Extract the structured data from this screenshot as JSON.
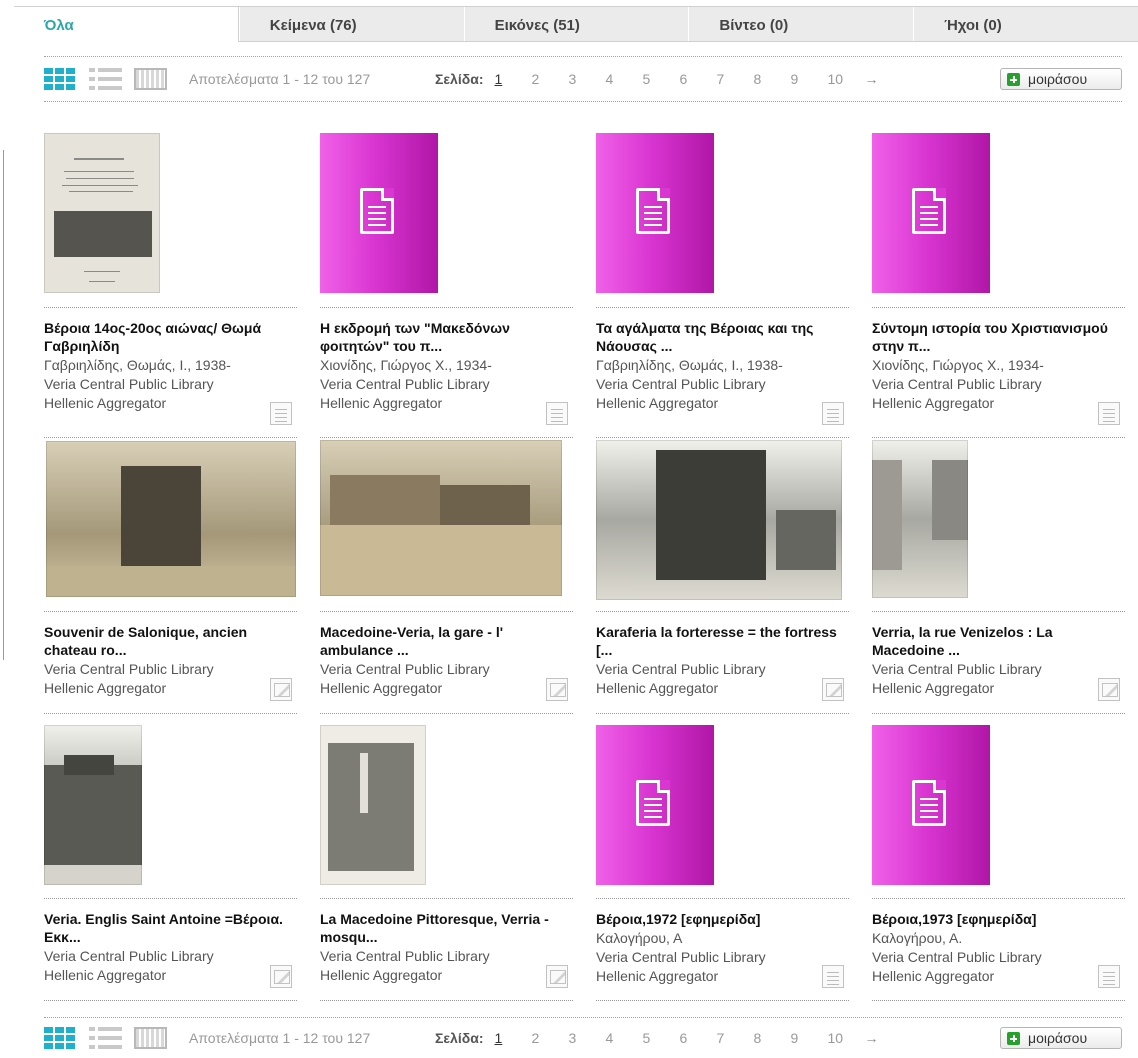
{
  "tabs": [
    "Όλα",
    "Κείμενα (76)",
    "Εικόνες (51)",
    "Βίντεο (0)",
    "Ήχοι (0)"
  ],
  "pagination": {
    "results": "Αποτελέσματα 1 - 12 του 127",
    "page_label": "Σελίδα:",
    "pages": [
      "1",
      "2",
      "3",
      "4",
      "5",
      "6",
      "7",
      "8",
      "9",
      "10"
    ],
    "next": "→",
    "share": "μοιράσου"
  },
  "items": [
    {
      "title": "Βέροια 14ος-20ος αιώνας/ Θωμά Γαβριηλίδη",
      "author": "Γαβριηλίδης, Θωμάς, Ι., 1938-",
      "library": "Veria Central Public Library",
      "aggregator": "Hellenic Aggregator",
      "type": "document-icon"
    },
    {
      "title": "Η εκδρομή των \"Μακεδόνων φοιτητών\" του π...",
      "author": "Χιονίδης, Γιώργος Χ., 1934-",
      "library": "Veria Central Public Library",
      "aggregator": "Hellenic Aggregator",
      "type": "document-icon"
    },
    {
      "title": "Τα αγάλματα της Βέροιας και της Νάουσας ...",
      "author": "Γαβριηλίδης, Θωμάς, Ι., 1938-",
      "library": "Veria Central Public Library",
      "aggregator": "Hellenic Aggregator",
      "type": "document-icon"
    },
    {
      "title": "Σύντομη ιστορία του Χριστιανισμού στην π...",
      "author": "Χιονίδης, Γιώργος Χ., 1934-",
      "library": "Veria Central Public Library",
      "aggregator": "Hellenic Aggregator",
      "type": "document-icon"
    },
    {
      "title": "Souvenir de Salonique, ancien chateau ro...",
      "author": "",
      "library": "Veria Central Public Library",
      "aggregator": "Hellenic Aggregator",
      "type": "image-icon"
    },
    {
      "title": "Macedoine-Veria, la gare - l' ambulance ...",
      "author": "",
      "library": "Veria Central Public Library",
      "aggregator": "Hellenic Aggregator",
      "type": "image-icon"
    },
    {
      "title": "Karaferia la forteresse = the fortress [...",
      "author": "",
      "library": "Veria Central Public Library",
      "aggregator": "Hellenic Aggregator",
      "type": "image-icon"
    },
    {
      "title": "Verria, la rue Venizelos : La Macedoine ...",
      "author": "",
      "library": "Veria Central Public Library",
      "aggregator": "Hellenic Aggregator",
      "type": "image-icon"
    },
    {
      "title": "Veria. Englis Saint Antoine =Βέροια. Εκκ...",
      "author": "",
      "library": "Veria Central Public Library",
      "aggregator": "Hellenic Aggregator",
      "type": "image-icon"
    },
    {
      "title": "La Macedoine Pittoresque, Verria - mosqu...",
      "author": "",
      "library": "Veria Central Public Library",
      "aggregator": "Hellenic Aggregator",
      "type": "image-icon"
    },
    {
      "title": "Βέροια,1972 [εφημερίδα]",
      "author": "Καλογήρου, Α",
      "library": "Veria Central Public Library",
      "aggregator": "Hellenic Aggregator",
      "type": "document-icon"
    },
    {
      "title": "Βέροια,1973 [εφημερίδα]",
      "author": "Καλογήρου, Α.",
      "library": "Veria Central Public Library",
      "aggregator": "Hellenic Aggregator",
      "type": "document-icon"
    }
  ]
}
